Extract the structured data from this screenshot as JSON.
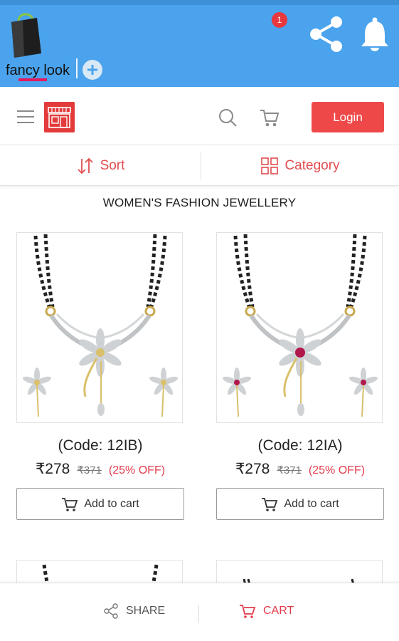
{
  "tab": {
    "label": "fancy look"
  },
  "header": {
    "cart_count": "1",
    "login_label": "Login"
  },
  "sortbar": {
    "sort_label": "Sort",
    "category_label": "Category"
  },
  "section": {
    "title": "WOMEN'S FASHION JEWELLERY"
  },
  "products": [
    {
      "code": "(Code: 12IB)",
      "price": "₹278",
      "mrp": "₹371",
      "discount": "(25% OFF)",
      "add_label": "Add to cart",
      "stone_color": "#e8e8e8"
    },
    {
      "code": "(Code: 12IA)",
      "price": "₹278",
      "mrp": "₹371",
      "discount": "(25% OFF)",
      "add_label": "Add to cart",
      "stone_color": "#b0174b"
    }
  ],
  "bottom": {
    "share_label": "SHARE",
    "cart_label": "CART"
  },
  "colors": {
    "appbar": "#4aa3ec",
    "accent": "#ef4848",
    "tab_underline": "#e5195f"
  }
}
